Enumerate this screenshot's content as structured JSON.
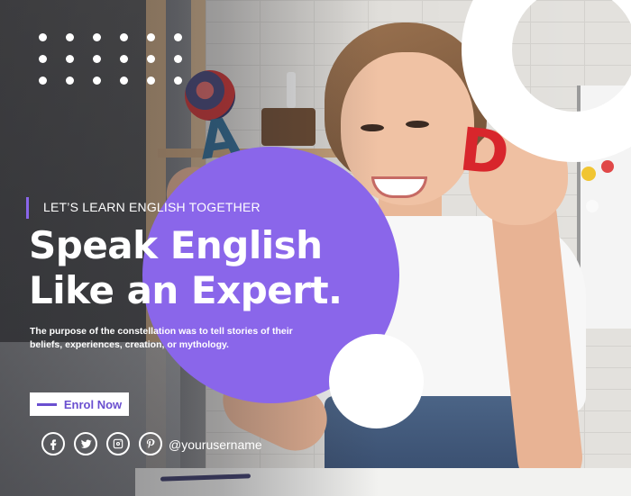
{
  "banner": {
    "tagline": "LET’S LEARN ENGLISH TOGETHER",
    "headline_line1": "Speak English",
    "headline_line2": "Like an Expert.",
    "description": "The purpose of the constellation was to tell stories of their beliefs, experiences, creation, or mythology.",
    "cta_label": "Enrol Now",
    "handle": "@yourusername"
  },
  "photo": {
    "letter_left": "A",
    "letter_right": "D"
  },
  "social": [
    "facebook-icon",
    "twitter-icon",
    "instagram-icon",
    "pinterest-icon"
  ],
  "colors": {
    "accent": "#8a66ea",
    "cta_text": "#6a4fd0",
    "white": "#ffffff"
  }
}
